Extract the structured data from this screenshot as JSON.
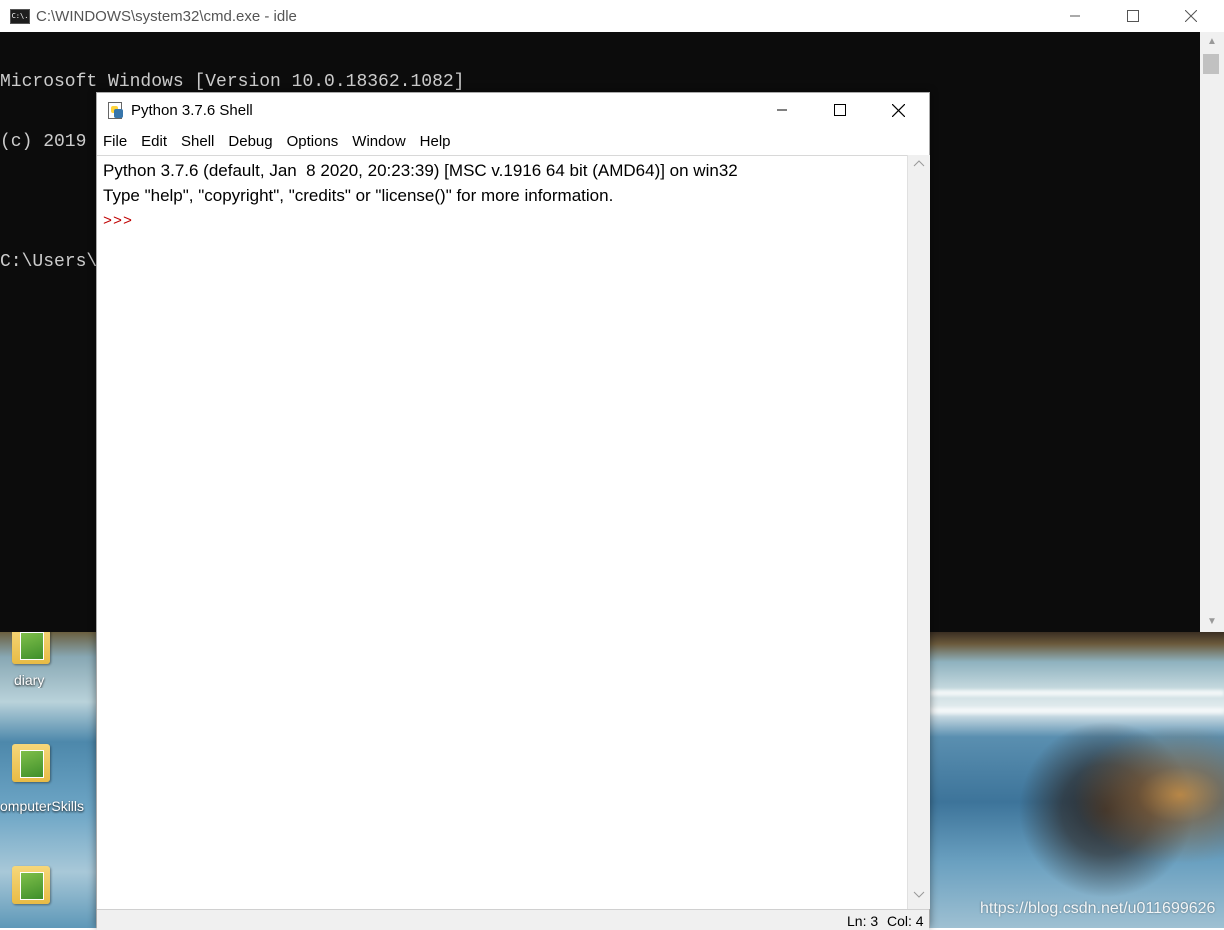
{
  "cmd": {
    "title": "C:\\WINDOWS\\system32\\cmd.exe - idle",
    "icon_text": "C:\\.",
    "lines": [
      "Microsoft Windows [Version 10.0.18362.1082]",
      "(c) 2019 Microsoft Corporation. Alle Rechte vorbehalten.",
      "",
      "C:\\Users\\l"
    ]
  },
  "idle": {
    "title": "Python 3.7.6 Shell",
    "menu": [
      "File",
      "Edit",
      "Shell",
      "Debug",
      "Options",
      "Window",
      "Help"
    ],
    "lines": [
      "Python 3.7.6 (default, Jan  8 2020, 20:23:39) [MSC v.1916 64 bit (AMD64)] on win32",
      "Type \"help\", \"copyright\", \"credits\" or \"license()\" for more information."
    ],
    "prompt": ">>>",
    "status": {
      "ln": "Ln: 3",
      "col": "Col: 4"
    }
  },
  "desktop": {
    "icons": [
      "diary",
      "omputerSkills",
      ""
    ]
  },
  "watermark": "https://blog.csdn.net/u011699626"
}
